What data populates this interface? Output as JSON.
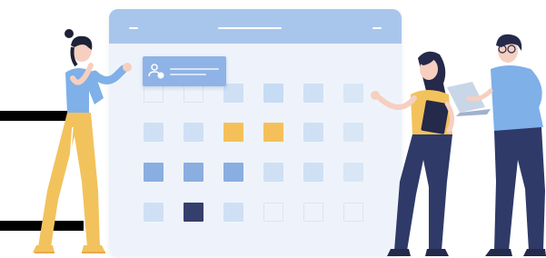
{
  "illustration": {
    "theme": "team-calendar-scheduling",
    "colors": {
      "titlebar": "#a8c6ec",
      "window_bg": "#eef3fb",
      "cell_light": "#cfe0f5",
      "cell_mid": "#8aaedf",
      "cell_accent": "#f5c05a",
      "cell_dark": "#353f6e",
      "figure_shirt": "#7fb0e8",
      "figure_pants_yellow": "#f2c25c",
      "figure_pants_navy": "#2f3a68"
    },
    "icons": [
      "user-add-icon"
    ]
  }
}
